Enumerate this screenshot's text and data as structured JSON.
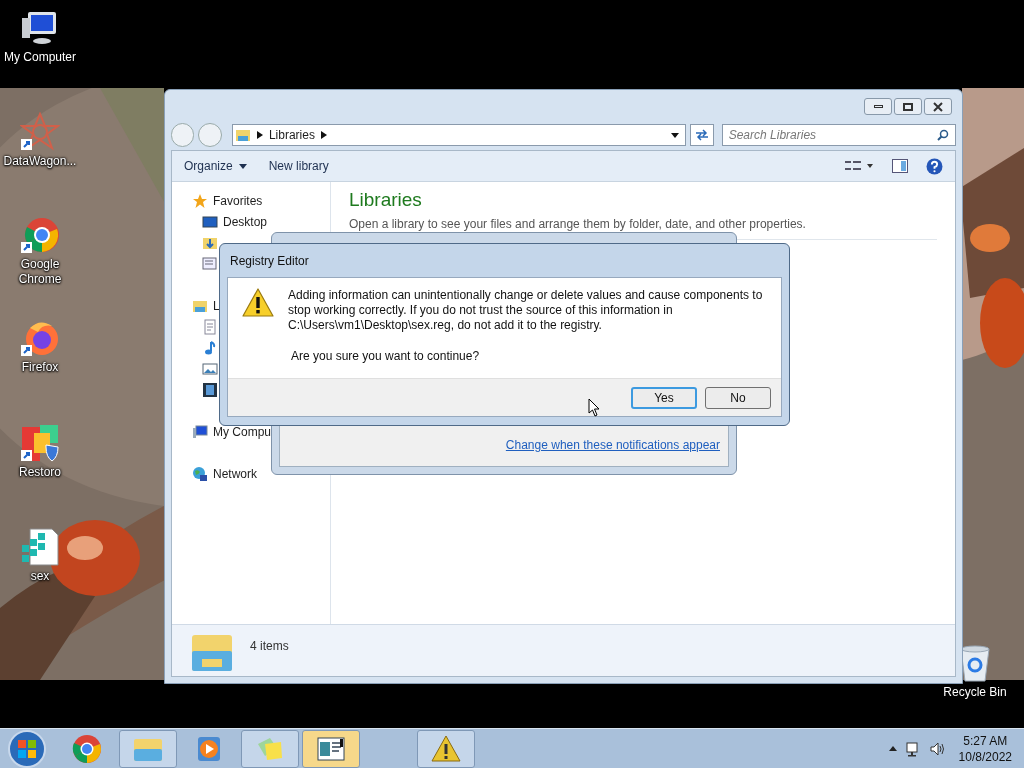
{
  "desktop_icons": [
    {
      "kind": "computer",
      "label": "My Computer"
    },
    {
      "kind": "star",
      "label": "DataWagon..."
    },
    {
      "kind": "chrome",
      "label": "Google Chrome"
    },
    {
      "kind": "firefox",
      "label": "Firefox"
    },
    {
      "kind": "restoro",
      "label": "Restoro"
    },
    {
      "kind": "regfile",
      "label": "sex"
    },
    {
      "kind": "recycle",
      "label": "Recycle Bin"
    }
  ],
  "explorer": {
    "address": "Libraries",
    "search": {
      "placeholder": "Search Libraries"
    },
    "toolbar": [
      {
        "label": "Organize",
        "kind": "menu"
      },
      {
        "label": "New library",
        "kind": "plain"
      }
    ],
    "nav": [
      {
        "kind": "star",
        "label": "Favorites",
        "children": [
          {
            "kind": "desktop",
            "label": "Desktop"
          },
          {
            "kind": "downloads"
          },
          {
            "kind": "recent"
          }
        ]
      },
      {
        "kind": "library",
        "label": "L",
        "children": [
          {
            "kind": "doc"
          },
          {
            "kind": "music"
          },
          {
            "kind": "pictures"
          },
          {
            "kind": "video"
          }
        ]
      },
      {
        "kind": "computer",
        "label": "My Compu"
      },
      {
        "kind": "network",
        "label": "Network"
      }
    ],
    "heading": "Libraries",
    "subtitle": "Open a library to see your files and arrange them by folder, date, and other properties.",
    "status": "4 items"
  },
  "uac_dialog": {
    "link": "Change when these notifications appear"
  },
  "dialog": {
    "title": "Registry Editor",
    "message": "Adding information can unintentionally change or delete values and cause components to stop working correctly. If you do not trust the source of this information in C:\\Users\\vm1\\Desktop\\sex.reg, do not add it to the registry.",
    "question": "Are you sure you want to continue?",
    "buttons": [
      {
        "label": "Yes",
        "selected": true
      },
      {
        "label": "No",
        "selected": false
      }
    ]
  },
  "taskbar": {
    "items": [
      {
        "kind": "chrome",
        "open": false,
        "selected": false
      },
      {
        "kind": "explorer",
        "open": true,
        "selected": false
      },
      {
        "kind": "media",
        "open": false,
        "selected": false
      },
      {
        "kind": "sticky",
        "open": true,
        "selected": false
      },
      {
        "kind": "regedit",
        "open": true,
        "selected": true
      },
      {
        "kind": "warning",
        "open": true,
        "selected": false
      }
    ],
    "time": "5:27 AM",
    "date": "10/8/2022"
  }
}
